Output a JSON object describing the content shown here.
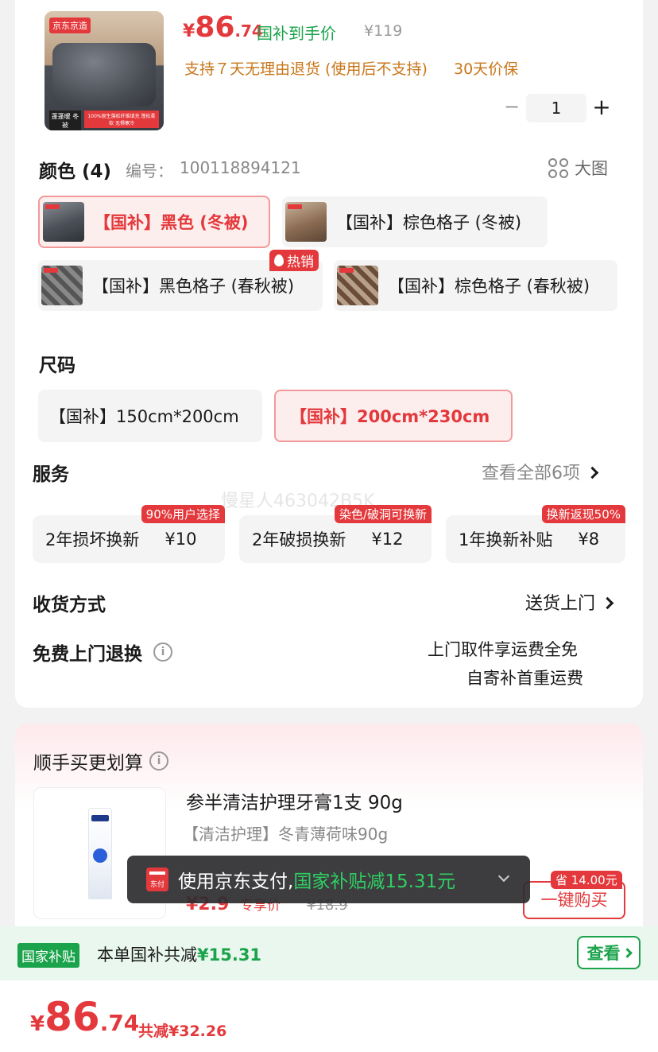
{
  "product": {
    "thumb_brand": "京东京造",
    "thumb_caption_left": "蓬蓬暖 冬被",
    "thumb_caption_right": "100%原生藻松纤维填充 蓬松柔软 无惧寒冷",
    "price_currency": "¥",
    "price_int": "86",
    "price_dec": ".74",
    "price_label": "国补到手价",
    "original_price": "¥119",
    "return_policy": "支持７天无理由退货 (使用后不支持)",
    "price_protect": "30天价保",
    "quantity": "1",
    "minus": "−",
    "plus": "+"
  },
  "color": {
    "title": "颜色 (4)",
    "sku_label": "编号：",
    "sku": "100118894121",
    "big_image": "大图",
    "options": [
      {
        "label": "【国补】黑色 (冬被)",
        "selected": true
      },
      {
        "label": "【国补】棕色格子 (冬被)",
        "selected": false
      },
      {
        "label": "【国补】黑色格子 (春秋被)",
        "selected": false
      },
      {
        "label": "【国补】棕色格子 (春秋被)",
        "selected": false
      }
    ],
    "hot_badge": "热销"
  },
  "size": {
    "title": "尺码",
    "options": [
      {
        "label": "【国补】150cm*200cm",
        "selected": false
      },
      {
        "label": "【国补】200cm*230cm",
        "selected": true
      }
    ]
  },
  "service": {
    "title": "服务",
    "view_all": "查看全部6项",
    "items": [
      {
        "name": "2年损坏换新",
        "price": "¥10",
        "tag": "90%用户选择"
      },
      {
        "name": "2年破损换新",
        "price": "¥12",
        "tag": "染色/破洞可换新"
      },
      {
        "name": "1年换新补贴",
        "price": "¥8",
        "tag": "换新返现50%"
      }
    ]
  },
  "watermark": "慢星人463042B5K",
  "delivery": {
    "title": "收货方式",
    "value": "送货上门"
  },
  "free_return": {
    "title": "免费上门退换",
    "line1": "上门取件享运费全免",
    "line2": "自寄补首重运费"
  },
  "bundle": {
    "title": "顺手买更划算",
    "product_title": "参半清洁护理牙膏1支 90g",
    "variant": "【清洁护理】冬青薄荷味90g",
    "price": "¥2.9",
    "price_label": "专享价",
    "orig_price": "¥18.9",
    "save_badge": "省 14.00元",
    "buy_button": "一键购买"
  },
  "toast": {
    "pay_icon": "东付",
    "text": "使用京东支付,",
    "highlight": "国家补贴减15.31元"
  },
  "subsidy_bar": {
    "badge": "国家补贴",
    "text": "本单国补共减",
    "amount": "¥15.31",
    "button": "查看"
  },
  "footer": {
    "currency": "¥",
    "price_int": "86",
    "price_dec": ".74",
    "discount": "共减¥32.26"
  },
  "colors": {
    "accent_red": "#e4393c",
    "green": "#1aa34a",
    "orange": "#c9761a"
  }
}
